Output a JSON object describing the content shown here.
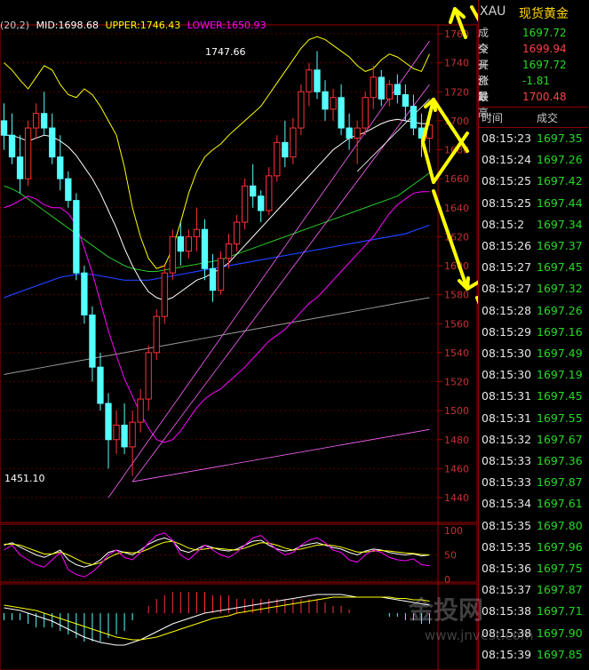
{
  "header": {
    "symbol": "XAU",
    "name": "现货黄金"
  },
  "quote": [
    {
      "label": "成交",
      "value": "1697.72",
      "color": "#28d828"
    },
    {
      "label": "今开",
      "value": "1699.94",
      "color": "#ff4040"
    },
    {
      "label": "买价1",
      "value": "1697.72",
      "color": "#28d828"
    },
    {
      "label": "涨跌",
      "value": "-1.81",
      "color": "#28d828"
    },
    {
      "label": "最高",
      "value": "1700.48",
      "color": "#ff4040"
    }
  ],
  "ticks_header": {
    "time": "时间",
    "price": "成交"
  },
  "ticks": [
    {
      "time": "08:15:23",
      "price": "1697.35"
    },
    {
      "time": "08:15:24",
      "price": "1697.26"
    },
    {
      "time": "08:15:25",
      "price": "1697.42"
    },
    {
      "time": "08:15:25",
      "price": "1697.44"
    },
    {
      "time": "08:15:2",
      "price": "1697.34"
    },
    {
      "time": "08:15:26",
      "price": "1697.37"
    },
    {
      "time": "08:15:27",
      "price": "1697.45"
    },
    {
      "time": "08:15:27",
      "price": "1697.32"
    },
    {
      "time": "08:15:28",
      "price": "1697.26"
    },
    {
      "time": "08:15:29",
      "price": "1697.16"
    },
    {
      "time": "08:15:30",
      "price": "1697.49"
    },
    {
      "time": "08:15:30",
      "price": "1697.19"
    },
    {
      "time": "08:15:31",
      "price": "1697.45"
    },
    {
      "time": "08:15:31",
      "price": "1697.55"
    },
    {
      "time": "08:15:32",
      "price": "1697.67"
    },
    {
      "time": "08:15:33",
      "price": "1697.36"
    },
    {
      "time": "08:15:33",
      "price": "1697.87"
    },
    {
      "time": "08:15:34",
      "price": "1697.61"
    },
    {
      "time": "08:15:35",
      "price": "1697.80"
    },
    {
      "time": "08:15:35",
      "price": "1697.96"
    },
    {
      "time": "08:15:36",
      "price": "1697.75"
    },
    {
      "time": "08:15:37",
      "price": "1697.87"
    },
    {
      "time": "08:15:38",
      "price": "1697.71"
    },
    {
      "time": "08:15:38",
      "price": "1697.90"
    },
    {
      "time": "08:15:39",
      "price": "1697.85"
    }
  ],
  "legend": {
    "prefix": "(20,2)",
    "mid": "MID:1698.68",
    "upper": "UPPER:1746.43",
    "lower": "LOWER:1650.93",
    "colors": {
      "mid": "#ffffff",
      "upper": "#ffff00",
      "lower": "#ff00ff"
    }
  },
  "watermark": {
    "logo": "金投网",
    "url": "www.jnvest.com"
  },
  "chart_data": {
    "type": "candlestick",
    "ylim": [
      1440,
      1760
    ],
    "yticks": [
      1440,
      1460,
      1480,
      1500,
      1520,
      1540,
      1560,
      1580,
      1600,
      1620,
      1640,
      1660,
      1680,
      1700,
      1720,
      1740,
      1760
    ],
    "annotations": [
      {
        "text": "1747.66",
        "value": 1747.66
      },
      {
        "text": "1451.10",
        "value": 1451.1
      }
    ],
    "candles": [
      [
        1700,
        1712,
        1680,
        1690
      ],
      [
        1690,
        1705,
        1670,
        1675
      ],
      [
        1675,
        1690,
        1650,
        1660
      ],
      [
        1660,
        1700,
        1655,
        1695
      ],
      [
        1695,
        1712,
        1688,
        1705
      ],
      [
        1705,
        1720,
        1690,
        1695
      ],
      [
        1695,
        1705,
        1670,
        1675
      ],
      [
        1675,
        1690,
        1652,
        1660
      ],
      [
        1660,
        1665,
        1640,
        1645
      ],
      [
        1645,
        1650,
        1590,
        1595
      ],
      [
        1595,
        1600,
        1560,
        1566
      ],
      [
        1566,
        1572,
        1520,
        1530
      ],
      [
        1530,
        1540,
        1500,
        1505
      ],
      [
        1505,
        1512,
        1460,
        1480
      ],
      [
        1480,
        1500,
        1470,
        1490
      ],
      [
        1490,
        1505,
        1470,
        1475
      ],
      [
        1475,
        1500,
        1455,
        1492
      ],
      [
        1492,
        1515,
        1485,
        1508
      ],
      [
        1508,
        1545,
        1500,
        1540
      ],
      [
        1540,
        1570,
        1535,
        1565
      ],
      [
        1565,
        1600,
        1560,
        1595
      ],
      [
        1595,
        1625,
        1590,
        1620
      ],
      [
        1620,
        1630,
        1600,
        1610
      ],
      [
        1610,
        1625,
        1605,
        1620
      ],
      [
        1620,
        1640,
        1610,
        1625
      ],
      [
        1625,
        1632,
        1590,
        1598
      ],
      [
        1598,
        1608,
        1575,
        1583
      ],
      [
        1583,
        1610,
        1580,
        1605
      ],
      [
        1605,
        1622,
        1598,
        1615
      ],
      [
        1615,
        1635,
        1610,
        1630
      ],
      [
        1630,
        1660,
        1625,
        1655
      ],
      [
        1655,
        1670,
        1640,
        1648
      ],
      [
        1648,
        1652,
        1630,
        1638
      ],
      [
        1638,
        1668,
        1635,
        1662
      ],
      [
        1662,
        1690,
        1658,
        1685
      ],
      [
        1685,
        1700,
        1668,
        1675
      ],
      [
        1675,
        1702,
        1670,
        1695
      ],
      [
        1695,
        1725,
        1690,
        1720
      ],
      [
        1720,
        1740,
        1710,
        1735
      ],
      [
        1735,
        1748,
        1715,
        1720
      ],
      [
        1720,
        1728,
        1700,
        1708
      ],
      [
        1708,
        1722,
        1700,
        1716
      ],
      [
        1716,
        1725,
        1690,
        1695
      ],
      [
        1695,
        1705,
        1680,
        1688
      ],
      [
        1688,
        1700,
        1670,
        1695
      ],
      [
        1695,
        1720,
        1690,
        1716
      ],
      [
        1716,
        1738,
        1708,
        1730
      ],
      [
        1730,
        1735,
        1710,
        1715
      ],
      [
        1715,
        1728,
        1710,
        1725
      ],
      [
        1725,
        1732,
        1712,
        1718
      ],
      [
        1718,
        1725,
        1700,
        1710
      ],
      [
        1710,
        1718,
        1690,
        1695
      ],
      [
        1695,
        1705,
        1675,
        1688
      ],
      [
        1688,
        1700,
        1678,
        1697
      ]
    ],
    "bb_upper": [
      1740,
      1735,
      1728,
      1722,
      1730,
      1738,
      1735,
      1725,
      1718,
      1716,
      1722,
      1718,
      1710,
      1700,
      1690,
      1668,
      1640,
      1620,
      1605,
      1598,
      1600,
      1612,
      1630,
      1650,
      1665,
      1675,
      1680,
      1684,
      1690,
      1695,
      1700,
      1705,
      1710,
      1718,
      1726,
      1734,
      1742,
      1750,
      1756,
      1758,
      1756,
      1752,
      1748,
      1744,
      1738,
      1734,
      1736,
      1742,
      1746,
      1744,
      1740,
      1736,
      1734,
      1746
    ],
    "bb_mid": [
      1690,
      1690,
      1688,
      1686,
      1688,
      1690,
      1689,
      1686,
      1682,
      1676,
      1668,
      1660,
      1650,
      1638,
      1626,
      1612,
      1600,
      1590,
      1582,
      1578,
      1576,
      1578,
      1582,
      1586,
      1590,
      1592,
      1595,
      1598,
      1602,
      1608,
      1614,
      1620,
      1626,
      1632,
      1638,
      1644,
      1650,
      1656,
      1662,
      1668,
      1674,
      1680,
      1684,
      1688,
      1690,
      1692,
      1695,
      1698,
      1700,
      1701,
      1700,
      1699,
      1698,
      1698
    ],
    "bb_lower": [
      1640,
      1642,
      1645,
      1648,
      1646,
      1642,
      1640,
      1640,
      1636,
      1628,
      1612,
      1595,
      1575,
      1555,
      1538,
      1522,
      1510,
      1498,
      1488,
      1480,
      1478,
      1480,
      1486,
      1494,
      1502,
      1508,
      1512,
      1515,
      1520,
      1525,
      1530,
      1536,
      1542,
      1548,
      1552,
      1556,
      1562,
      1568,
      1574,
      1578,
      1584,
      1590,
      1596,
      1602,
      1608,
      1614,
      1620,
      1628,
      1636,
      1642,
      1646,
      1650,
      1651,
      1651
    ],
    "ma_green": [
      1655,
      1653,
      1650,
      1646,
      1642,
      1638,
      1634,
      1630,
      1626,
      1622,
      1618,
      1614,
      1610,
      1606,
      1603,
      1600,
      1598,
      1597,
      1596,
      1596,
      1597,
      1598,
      1599,
      1600,
      1601,
      1602,
      1603,
      1604,
      1606,
      1608,
      1610,
      1612,
      1614,
      1616,
      1618,
      1620,
      1622,
      1624,
      1626,
      1628,
      1630,
      1632,
      1634,
      1636,
      1638,
      1640,
      1642,
      1644,
      1646,
      1648,
      1652,
      1656,
      1660,
      1664
    ],
    "ma_blue": [
      1578,
      1580,
      1582,
      1584,
      1586,
      1588,
      1590,
      1592,
      1593,
      1594,
      1594,
      1594,
      1593,
      1592,
      1591,
      1590,
      1590,
      1590,
      1590,
      1591,
      1592,
      1593,
      1594,
      1595,
      1596,
      1597,
      1598,
      1599,
      1600,
      1601,
      1602,
      1603,
      1604,
      1605,
      1606,
      1607,
      1608,
      1609,
      1610,
      1611,
      1612,
      1613,
      1614,
      1615,
      1616,
      1617,
      1618,
      1619,
      1620,
      1621,
      1622,
      1624,
      1626,
      1628
    ],
    "ma_gray": [
      1525,
      1526,
      1527,
      1528,
      1529,
      1530,
      1531,
      1532,
      1533,
      1534,
      1535,
      1536,
      1537,
      1538,
      1539,
      1540,
      1541,
      1542,
      1543,
      1544,
      1545,
      1546,
      1547,
      1548,
      1549,
      1550,
      1551,
      1552,
      1553,
      1554,
      1555,
      1556,
      1557,
      1558,
      1559,
      1560,
      1561,
      1562,
      1563,
      1564,
      1565,
      1566,
      1567,
      1568,
      1569,
      1570,
      1571,
      1572,
      1573,
      1574,
      1575,
      1576,
      1577,
      1578
    ],
    "trendlines": [
      {
        "x0": 16,
        "y0": 1451,
        "x1": 53,
        "y1": 1487,
        "color": "#ff66ff"
      },
      {
        "x0": 16,
        "y0": 1451,
        "x1": 53,
        "y1": 1725,
        "color": "#ff66ff"
      },
      {
        "x0": 13,
        "y0": 1440,
        "x1": 53,
        "y1": 1755,
        "color": "#ff66ff"
      },
      {
        "x0": 44,
        "y0": 1665,
        "x1": 53,
        "y1": 1715,
        "color": "#ffffff"
      }
    ],
    "indicator1": {
      "ylim": [
        0,
        100
      ],
      "yticks": [
        0,
        50,
        100
      ],
      "series": [
        {
          "color": "#ffffff",
          "values": [
            70,
            75,
            66,
            58,
            50,
            45,
            52,
            60,
            40,
            30,
            25,
            30,
            40,
            55,
            60,
            55,
            50,
            60,
            72,
            80,
            85,
            78,
            60,
            55,
            62,
            70,
            65,
            60,
            58,
            62,
            70,
            78,
            80,
            70,
            62,
            58,
            60,
            68,
            72,
            75,
            70,
            65,
            62,
            55,
            50,
            58,
            62,
            60,
            55,
            52,
            50,
            52,
            48,
            50
          ]
        },
        {
          "color": "#ffff00",
          "values": [
            72,
            72,
            70,
            64,
            58,
            52,
            52,
            56,
            50,
            42,
            34,
            30,
            34,
            44,
            52,
            56,
            54,
            56,
            62,
            70,
            76,
            78,
            72,
            64,
            60,
            62,
            64,
            63,
            61,
            60,
            64,
            70,
            75,
            74,
            70,
            64,
            60,
            62,
            66,
            70,
            71,
            69,
            66,
            61,
            56,
            56,
            58,
            59,
            58,
            56,
            54,
            53,
            51,
            50
          ]
        },
        {
          "color": "#ff00ff",
          "values": [
            60,
            70,
            50,
            40,
            30,
            25,
            40,
            55,
            20,
            10,
            5,
            15,
            30,
            50,
            60,
            45,
            40,
            55,
            75,
            90,
            95,
            80,
            50,
            40,
            55,
            70,
            60,
            50,
            45,
            55,
            70,
            85,
            90,
            75,
            60,
            50,
            55,
            70,
            80,
            85,
            75,
            60,
            55,
            40,
            35,
            50,
            60,
            55,
            45,
            40,
            38,
            42,
            30,
            28
          ]
        }
      ]
    },
    "indicator2": {
      "series": [
        {
          "color": "#ffffff",
          "values": [
            4,
            3,
            2,
            0,
            -2,
            -4,
            -6,
            -9,
            -12,
            -15,
            -18,
            -20,
            -22,
            -23,
            -24,
            -24,
            -22,
            -20,
            -17,
            -14,
            -11,
            -8,
            -6,
            -4,
            -2,
            0,
            1,
            2,
            3,
            4,
            5,
            6,
            7,
            8,
            9,
            10,
            11,
            12,
            13,
            14,
            14,
            14,
            14,
            13,
            12,
            12,
            12,
            12,
            11,
            10,
            9,
            8,
            7,
            6
          ]
        },
        {
          "color": "#ffff00",
          "values": [
            6,
            5,
            4,
            3,
            2,
            0,
            -2,
            -4,
            -6,
            -8,
            -10,
            -12,
            -14,
            -16,
            -18,
            -19,
            -20,
            -20,
            -19,
            -18,
            -16,
            -14,
            -12,
            -10,
            -8,
            -6,
            -4,
            -3,
            -2,
            0,
            1,
            2,
            3,
            4,
            5,
            6,
            7,
            8,
            9,
            10,
            11,
            12,
            12,
            12,
            12,
            12,
            12,
            12,
            12,
            11,
            11,
            10,
            10,
            9
          ]
        }
      ],
      "histogram": [
        -2,
        -2,
        -2,
        -3,
        -4,
        -4,
        -4,
        -5,
        -6,
        -7,
        -8,
        -8,
        -8,
        -7,
        -6,
        -5,
        -2,
        0,
        2,
        4,
        5,
        6,
        6,
        6,
        6,
        6,
        5,
        5,
        5,
        4,
        4,
        4,
        4,
        4,
        4,
        4,
        4,
        4,
        4,
        4,
        3,
        2,
        2,
        1,
        0,
        0,
        0,
        0,
        -1,
        -1,
        -2,
        -2,
        -3,
        -3
      ]
    }
  }
}
